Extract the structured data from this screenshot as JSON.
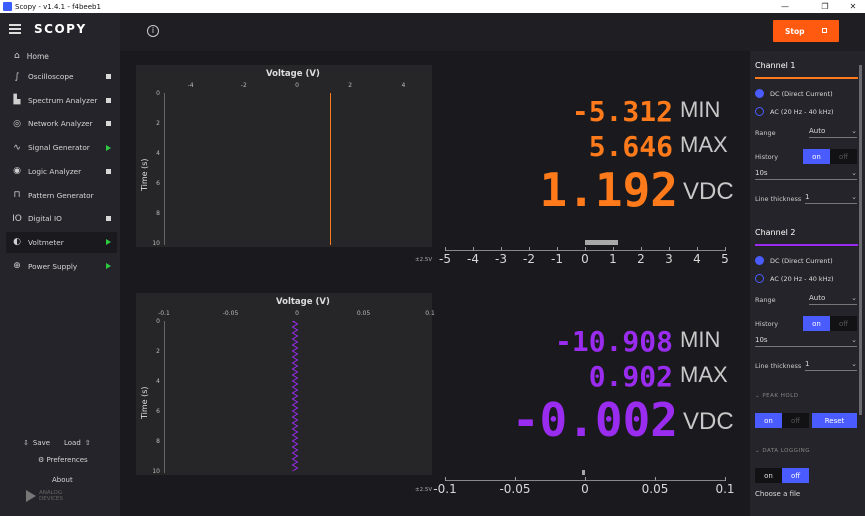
{
  "window": {
    "title": "Scopy - v1.4.1 - f4beeb1",
    "controls": [
      "—",
      "❐",
      "✕"
    ]
  },
  "sidebar": {
    "logo": "SCOPY",
    "home_label": "Home",
    "items": [
      {
        "label": "Oscilloscope",
        "icon": "oscilloscope-icon",
        "status": "stopped"
      },
      {
        "label": "Spectrum Analyzer",
        "icon": "spectrum-icon",
        "status": "stopped"
      },
      {
        "label": "Network Analyzer",
        "icon": "network-icon",
        "status": "stopped"
      },
      {
        "label": "Signal Generator",
        "icon": "signal-icon",
        "status": "running"
      },
      {
        "label": "Logic Analyzer",
        "icon": "logic-icon",
        "status": "stopped"
      },
      {
        "label": "Pattern Generator",
        "icon": "pattern-icon",
        "status": "none"
      },
      {
        "label": "Digital IO",
        "icon": "digital-io-icon",
        "status": "stopped"
      },
      {
        "label": "Voltmeter",
        "icon": "voltmeter-icon",
        "status": "running"
      },
      {
        "label": "Power Supply",
        "icon": "power-icon",
        "status": "running"
      }
    ],
    "save_label": "Save",
    "load_label": "Load",
    "preferences_label": "Preferences",
    "about_label": "About",
    "vendor_line1": "ANALOG",
    "vendor_line2": "DEVICES"
  },
  "toolbar": {
    "stop_label": "Stop"
  },
  "colors": {
    "channel1": "#ff7a1a",
    "channel2": "#9a2cf0",
    "accent": "#4a5cff",
    "stop": "#ff5a0f"
  },
  "channel1_plot": {
    "title": "Voltage (V)",
    "ylabel": "Time (s)",
    "x_ticks": [
      "-4",
      "-2",
      "0",
      "2",
      "4"
    ],
    "x_range": [
      -5,
      5
    ],
    "y_ticks": [
      "0",
      "2",
      "4",
      "6",
      "8",
      "10"
    ],
    "trace_value": 1.192
  },
  "channel2_plot": {
    "title": "Voltage (V)",
    "ylabel": "Time (s)",
    "x_ticks": [
      "-0.1",
      "-0.05",
      "0",
      "0.05",
      "0.1"
    ],
    "x_range": [
      -0.1,
      0.1
    ],
    "y_ticks": [
      "0",
      "2",
      "4",
      "6",
      "8",
      "10"
    ],
    "trace_value": -0.002
  },
  "channel1_readout": {
    "min": "-5.312",
    "min_label": "MIN",
    "max": "5.646",
    "max_label": "MAX",
    "value": "1.192",
    "unit": "VDC",
    "range_label": "±2.5V",
    "scale_ticks": [
      "-5",
      "-4",
      "-3",
      "-2",
      "-1",
      "0",
      "1",
      "2",
      "3",
      "4",
      "5"
    ]
  },
  "channel2_readout": {
    "min": "-10.908",
    "min_label": "MIN",
    "max": "0.902",
    "max_label": "MAX",
    "value": "-0.002",
    "unit": "VDC",
    "range_label": "±2.5V",
    "scale_ticks": [
      "-0.1",
      "-0.05",
      "0",
      "0.05",
      "0.1"
    ]
  },
  "settings": {
    "channel1": {
      "title": "Channel 1",
      "dc_label": "DC (Direct Current)",
      "ac_label": "AC (20 Hz - 40 kHz)",
      "mode": "DC",
      "range_label": "Range",
      "range_value": "Auto",
      "history_label": "History",
      "history_on": "on",
      "history_off": "off",
      "history_enabled": true,
      "history_duration": "10s",
      "line_label": "Line thickness",
      "line_value": "1"
    },
    "channel2": {
      "title": "Channel 2",
      "dc_label": "DC (Direct Current)",
      "ac_label": "AC (20 Hz - 40 kHz)",
      "mode": "DC",
      "range_label": "Range",
      "range_value": "Auto",
      "history_label": "History",
      "history_on": "on",
      "history_off": "off",
      "history_enabled": true,
      "history_duration": "10s",
      "line_label": "Line thickness",
      "line_value": "1"
    },
    "peak_hold_label": "PEAK HOLD",
    "peak_on": "on",
    "peak_off": "off",
    "peak_enabled": true,
    "reset_label": "Reset",
    "data_logging_label": "DATA LOGGING",
    "log_on": "on",
    "log_off": "off",
    "log_enabled": false,
    "choose_file_label": "Choose a file"
  }
}
